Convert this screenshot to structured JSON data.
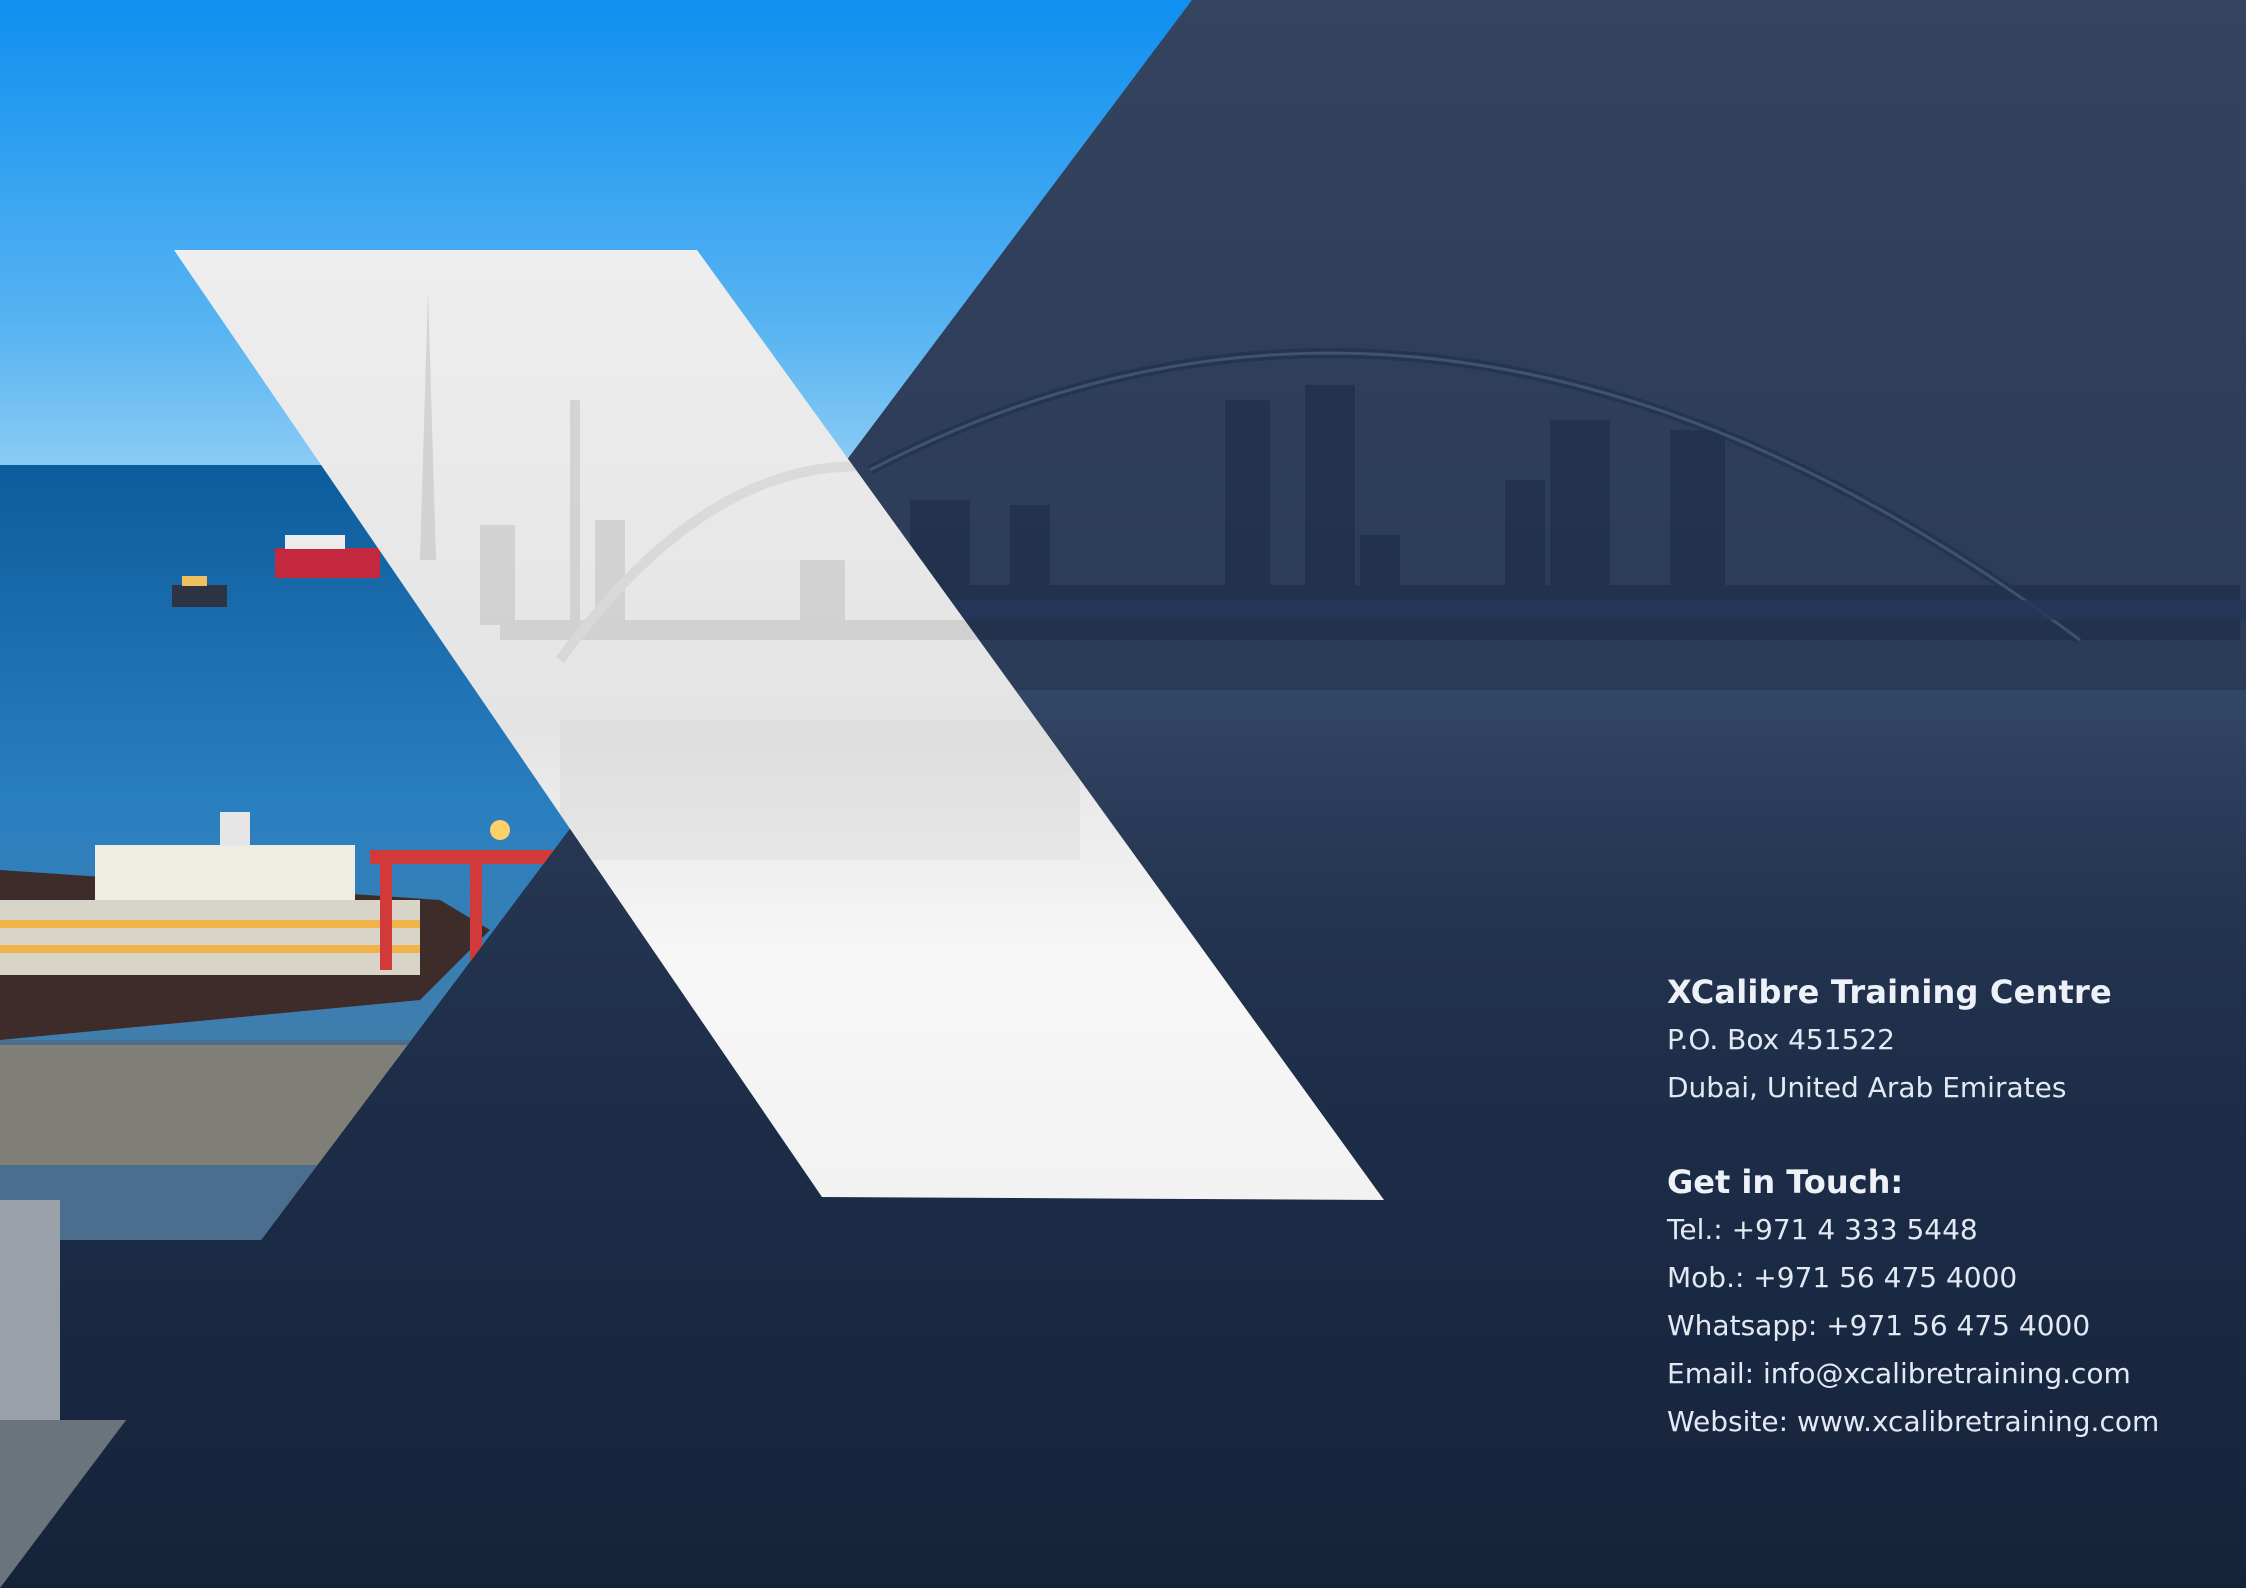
{
  "organization": {
    "name": "XCalibre Training Centre",
    "address_line1": "P.O. Box 451522",
    "address_line2": "Dubai, United Arab Emirates"
  },
  "contact": {
    "heading": "Get in Touch:",
    "tel": "Tel.: +971 4 333 5448",
    "mob": "Mob.: +971 56 475 4000",
    "whatsapp": "Whatsapp: +971 56 475 4000",
    "email": "Email: info@xcalibretraining.com",
    "website": "Website: www.xcalibretraining.com"
  },
  "colors": {
    "navy_dark": "#16233b",
    "navy_mid": "#2a3d5c",
    "sky_blue": "#1e9bf0",
    "sea_blue": "#1a6fb3",
    "white_shape": "#f4f4f4"
  }
}
